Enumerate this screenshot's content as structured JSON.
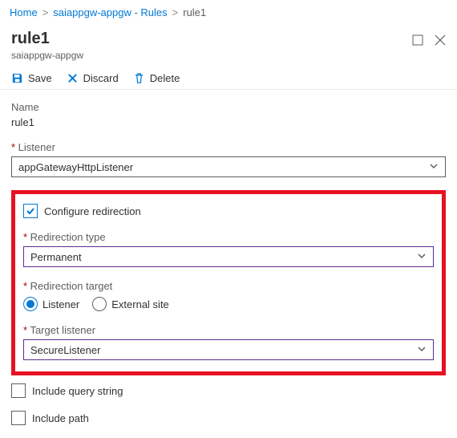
{
  "breadcrumb": {
    "home": "Home",
    "mid": "saiappgw-appgw - Rules",
    "current": "rule1"
  },
  "header": {
    "title": "rule1",
    "subtitle": "saiappgw-appgw"
  },
  "toolbar": {
    "save": "Save",
    "discard": "Discard",
    "delete": "Delete"
  },
  "form": {
    "name_label": "Name",
    "name_value": "rule1",
    "listener_label": "Listener",
    "listener_value": "appGatewayHttpListener",
    "configure_redirect_label": "Configure redirection",
    "redirection_type_label": "Redirection type",
    "redirection_type_value": "Permanent",
    "redirection_target_label": "Redirection target",
    "target_option_listener": "Listener",
    "target_option_external": "External site",
    "target_listener_label": "Target listener",
    "target_listener_value": "SecureListener",
    "include_query_label": "Include query string",
    "include_path_label": "Include path"
  }
}
